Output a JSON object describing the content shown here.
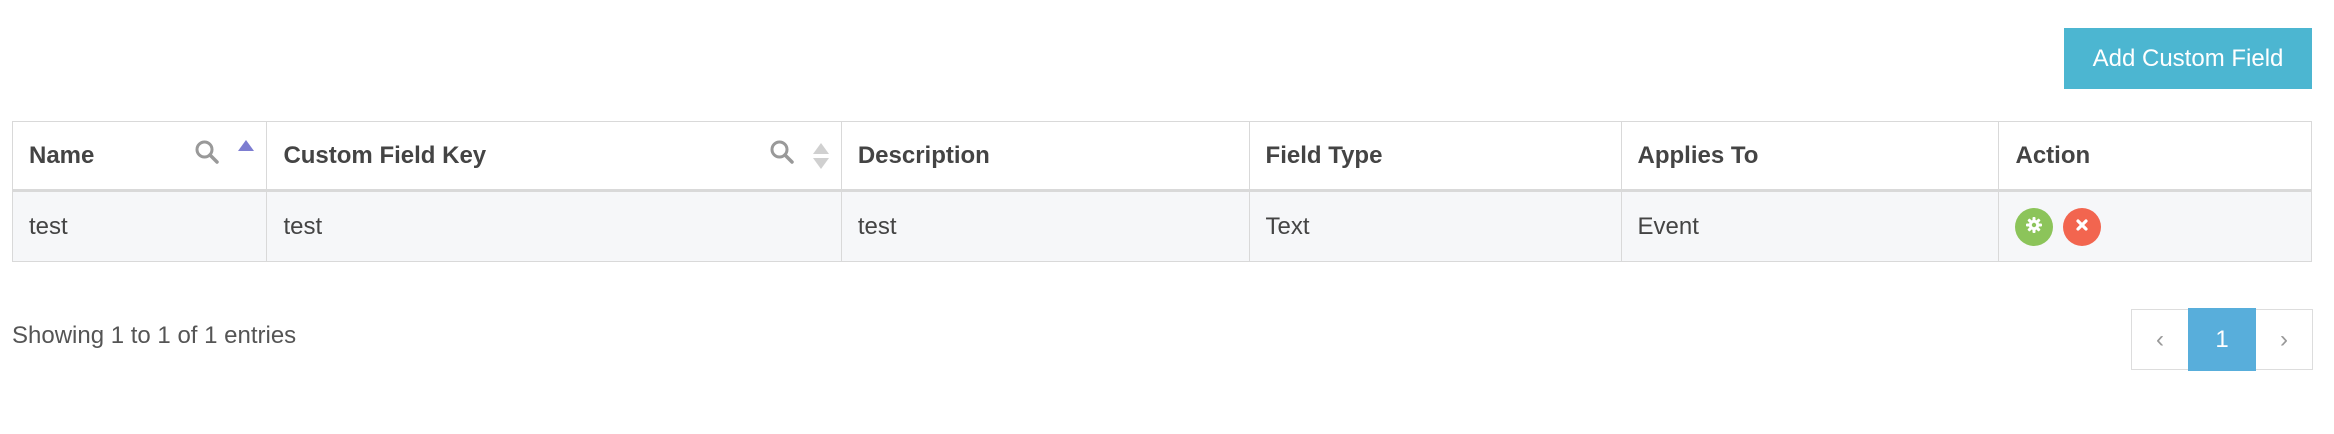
{
  "toolbar": {
    "add_label": "Add Custom Field",
    "add_color": "#4cb6d1"
  },
  "table": {
    "columns": [
      {
        "label": "Name",
        "searchable": true,
        "sort": "ascending"
      },
      {
        "label": "Custom Field Key",
        "searchable": true,
        "sort": "sortable"
      },
      {
        "label": "Description"
      },
      {
        "label": "Field Type"
      },
      {
        "label": "Applies To"
      },
      {
        "label": "Action"
      }
    ],
    "rows": [
      {
        "name": "test",
        "key": "test",
        "description": "test",
        "field_type": "Text",
        "applies_to": "Event",
        "actions": [
          "gear-icon",
          "close-icon"
        ]
      }
    ]
  },
  "footer": {
    "info": "Showing 1 to 1 of 1 entries"
  },
  "pagination": {
    "prev": "‹",
    "current": "1",
    "next": "›",
    "active_color": "#58aedb"
  },
  "colors": {
    "edit": "#8cc45a",
    "delete": "#f2654f",
    "sort_active": "#7d7dd1"
  }
}
